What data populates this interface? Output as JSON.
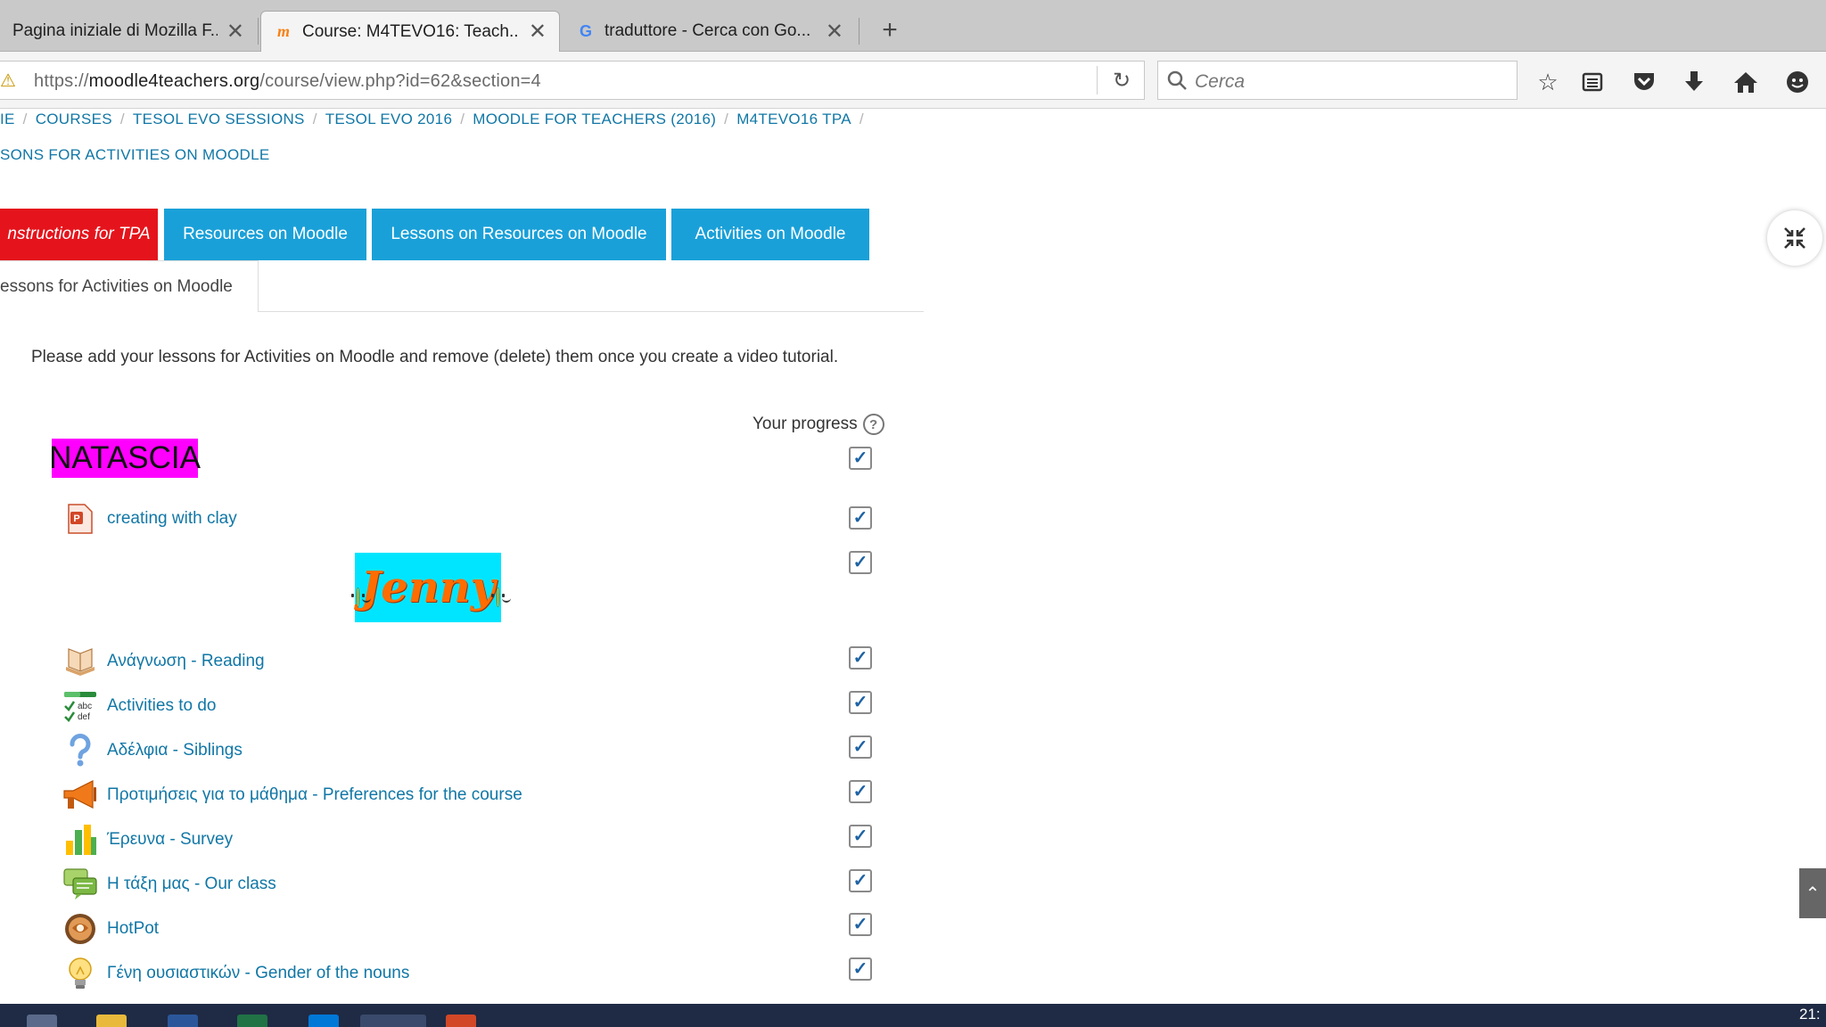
{
  "browser": {
    "tabs": [
      {
        "title": "Pagina iniziale di Mozilla F...",
        "favicon": "firefox-icon"
      },
      {
        "title": "Course: M4TEVO16: Teach...",
        "favicon": "moodle-icon",
        "active": true
      },
      {
        "title": "traduttore - Cerca con Go...",
        "favicon": "google-icon"
      }
    ],
    "url_prefix": "https://",
    "url_domain": "moodle4teachers.org",
    "url_path": "/course/view.php?id=62&section=4",
    "search_placeholder": "Cerca"
  },
  "breadcrumb": {
    "items": [
      "IE",
      "COURSES",
      "TESOL EVO SESSIONS",
      "TESOL EVO 2016",
      "MOODLE FOR TEACHERS (2016)",
      "M4TEVO16 TPA"
    ],
    "current": "SONS FOR ACTIVITIES ON MOODLE"
  },
  "section_tabs": [
    "nstructions for TPA",
    "Resources on Moodle",
    "Lessons on Resources on Moodle",
    "Activities on Moodle",
    "essons for Activities on Moodle"
  ],
  "intro_text": "Please add your lessons for Activities on Moodle and remove (delete) them once you create a video tutorial.",
  "progress_label": "Your progress",
  "labels": {
    "natascia": "NATASCIA",
    "jenny": "Jenny"
  },
  "activities": [
    {
      "name": "creating with clay",
      "icon": "powerpoint-file-icon",
      "completed": true
    },
    {
      "name": "Ανάγνωση - Reading",
      "icon": "lesson-icon",
      "completed": true
    },
    {
      "name": "Activities to do",
      "icon": "checklist-icon",
      "completed": true
    },
    {
      "name": "Αδέλφια - Siblings",
      "icon": "question-icon",
      "completed": true
    },
    {
      "name": "Προτιμήσεις για το μάθημα - Preferences for the course",
      "icon": "feedback-megaphone-icon",
      "completed": true
    },
    {
      "name": "Έρευνα - Survey",
      "icon": "survey-chart-icon",
      "completed": true
    },
    {
      "name": "Η τάξη μας - Our class",
      "icon": "forum-icon",
      "completed": true
    },
    {
      "name": "HotPot",
      "icon": "hotpot-icon",
      "completed": true
    },
    {
      "name": "Γένη ουσιαστικών - Gender of the nouns",
      "icon": "lightbulb-icon",
      "completed": true
    }
  ],
  "completion": {
    "natascia": true,
    "jenny": true
  },
  "colors": {
    "link": "#1177a6",
    "tab_blue": "#1aa0d8",
    "tab_red": "#e5141c",
    "natascia_bg": "#ff00ff",
    "jenny_bg": "#00e5ff"
  },
  "taskbar": {
    "clock": "21:"
  }
}
